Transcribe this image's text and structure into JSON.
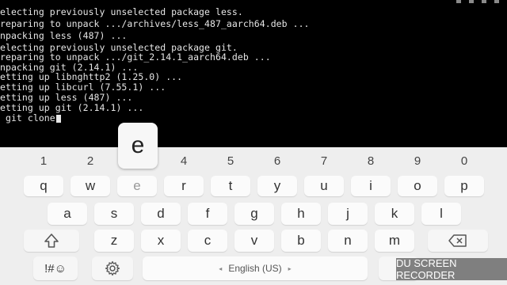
{
  "terminal": {
    "lines": [
      "electing previously unselected package less.",
      "reparing to unpack .../archives/less_487_aarch64.deb ...",
      "npacking less (487) ...",
      "electing previously unselected package git.",
      "reparing to unpack .../git_2.14.1_aarch64.deb ...",
      "npacking git (2.14.1) ...",
      "etting up libnghttp2 (1.25.0) ...",
      "etting up libcurl (7.55.1) ...",
      "etting up less (487) ...",
      "etting up git (2.14.1) ...",
      " git clone"
    ]
  },
  "keyboard": {
    "popup_key": "e",
    "number_row": [
      "1",
      "2",
      "3",
      "4",
      "5",
      "6",
      "7",
      "8",
      "9",
      "0"
    ],
    "row1": [
      "q",
      "w",
      "e",
      "r",
      "t",
      "y",
      "u",
      "i",
      "o",
      "p"
    ],
    "row2": [
      "a",
      "s",
      "d",
      "f",
      "g",
      "h",
      "j",
      "k",
      "l"
    ],
    "row3": [
      "z",
      "x",
      "c",
      "v",
      "b",
      "n",
      "m"
    ],
    "symbols_label": "!#☺",
    "space_label": "English (US)",
    "period_label": "."
  },
  "watermark": "DU SCREEN RECORDER",
  "icons": {
    "shift": "shift-icon",
    "backspace": "backspace-icon",
    "settings": "gear-icon"
  }
}
